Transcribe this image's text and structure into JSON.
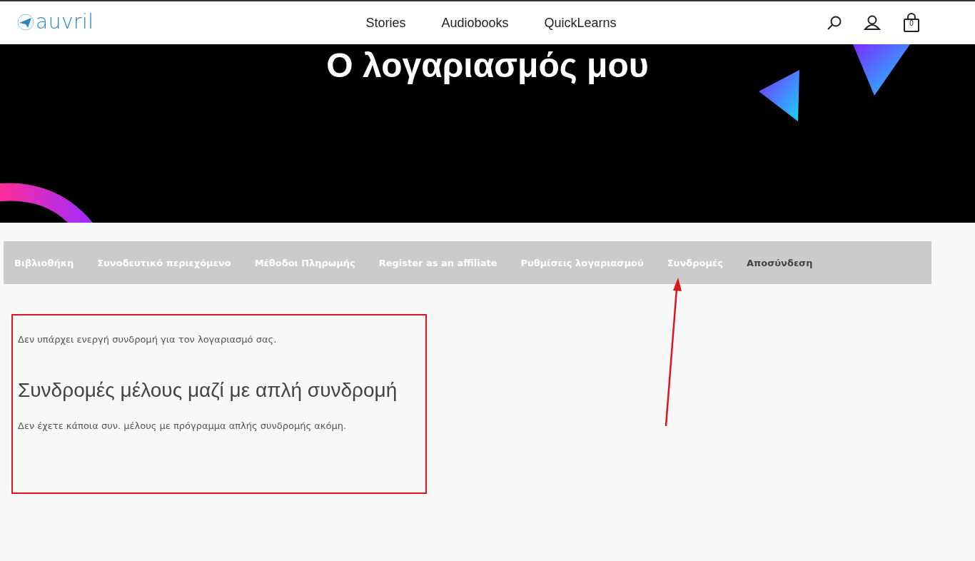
{
  "header": {
    "logo": "auvril",
    "nav": [
      "Stories",
      "Audiobooks",
      "QuickLearns"
    ],
    "cart_count": "0"
  },
  "hero": {
    "title": "Ο λογαριασμός μου"
  },
  "account_tabs": [
    {
      "label": "Βιβλιοθήκη",
      "selected": false
    },
    {
      "label": "Συνοδευτικό περιεχόμενο",
      "selected": false
    },
    {
      "label": "Μέθοδοι Πληρωμής",
      "selected": false
    },
    {
      "label": "Register as an affiliate",
      "selected": false
    },
    {
      "label": "Ρυθμίσεις λογαριασμού",
      "selected": false
    },
    {
      "label": "Συνδρομές",
      "selected": false
    },
    {
      "label": "Αποσύνδεση",
      "selected": true
    }
  ],
  "content": {
    "notice": "Δεν υπάρχει ενεργή συνδρομή για τον λογαριασμό σας.",
    "heading": "Συνδρομές μέλους μαζί με απλή συνδρομή",
    "message": "Δεν έχετε κάποια συν. μέλους με πρόγραμμα απλής συνδρομής ακόμη."
  }
}
